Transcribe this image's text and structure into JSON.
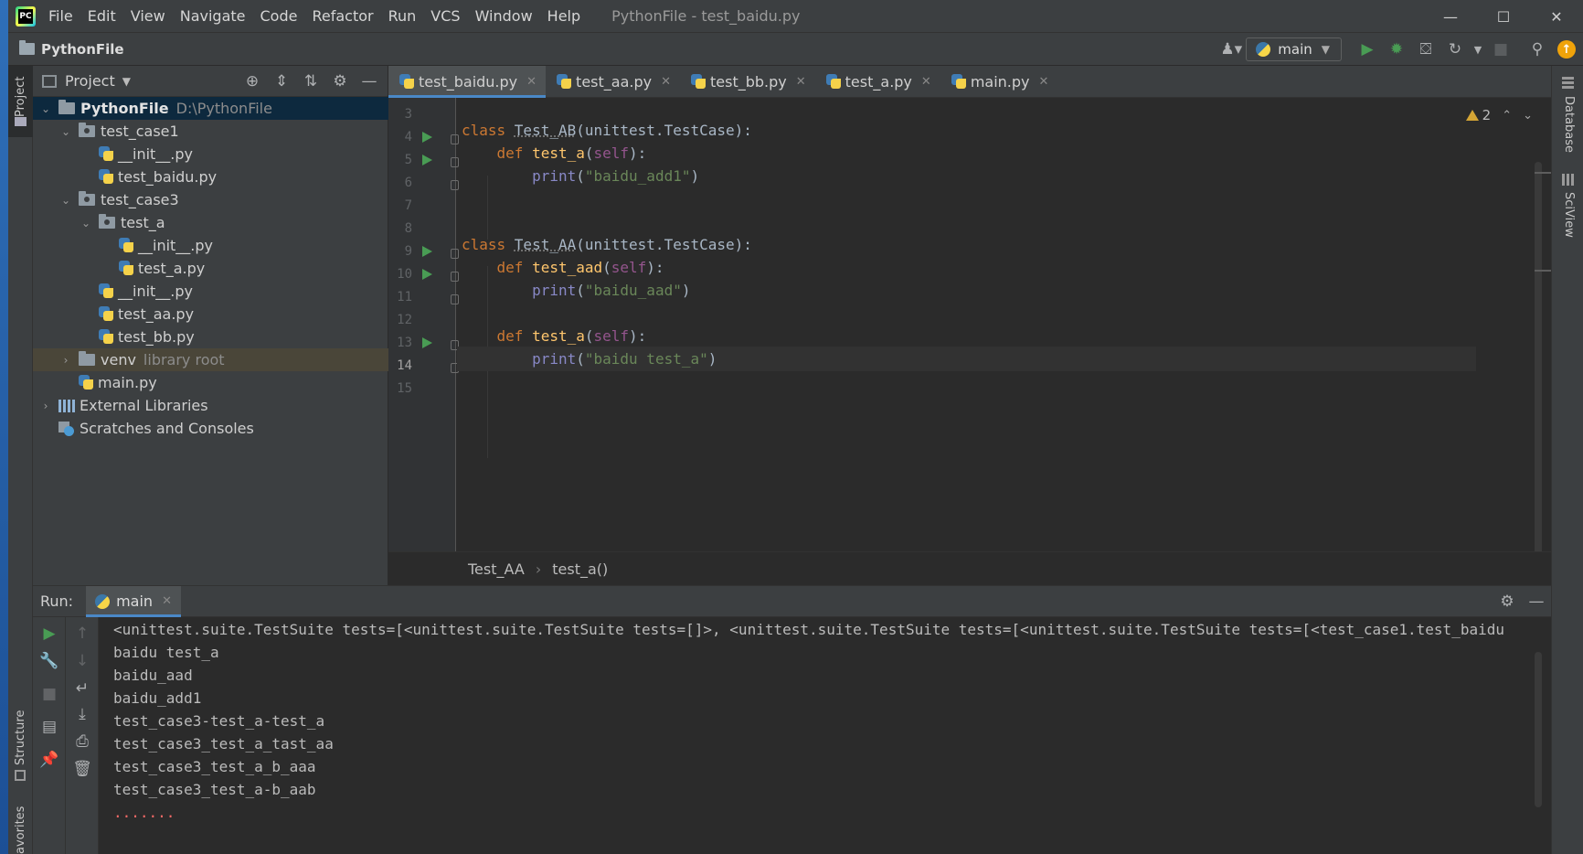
{
  "titlebar": {
    "menu": [
      "File",
      "Edit",
      "View",
      "Navigate",
      "Code",
      "Refactor",
      "Run",
      "VCS",
      "Window",
      "Help"
    ],
    "window_title": "PythonFile - test_baidu.py",
    "minimize_glyph": "—",
    "maximize_glyph": "☐",
    "close_glyph": "✕"
  },
  "navbar": {
    "project_name": "PythonFile",
    "run_config": "main"
  },
  "left_strip": {
    "project_label": "Project",
    "structure_label": "Structure",
    "favorites_label": "avorites"
  },
  "right_strip": {
    "database_label": "Database",
    "sciview_label": "SciView"
  },
  "project_panel": {
    "title": "Project",
    "tree": {
      "root_name": "PythonFile",
      "root_path": "D:\\PythonFile",
      "test_case1": "test_case1",
      "init1": "__init__.py",
      "test_baidu": "test_baidu.py",
      "test_case3": "test_case3",
      "test_a_dir": "test_a",
      "init_a": "__init__.py",
      "test_a_py": "test_a.py",
      "init3": "__init__.py",
      "test_aa": "test_aa.py",
      "test_bb": "test_bb.py",
      "venv": "venv",
      "venv_note": "library root",
      "main_py": "main.py",
      "external_libraries": "External Libraries",
      "scratches": "Scratches and Consoles"
    }
  },
  "editor": {
    "tabs": [
      {
        "label": "test_baidu.py",
        "active": true
      },
      {
        "label": "test_aa.py",
        "active": false
      },
      {
        "label": "test_bb.py",
        "active": false
      },
      {
        "label": "test_a.py",
        "active": false
      },
      {
        "label": "main.py",
        "active": false
      }
    ],
    "line_numbers": [
      "3",
      "4",
      "5",
      "6",
      "7",
      "8",
      "9",
      "10",
      "11",
      "12",
      "13",
      "14",
      "15"
    ],
    "current_line": "14",
    "code": {
      "l4_kw": "class ",
      "l4_name": "Test_AB",
      "l4_rest": "(unittest.TestCase):",
      "l5_kw": "def ",
      "l5_fn": "test_a",
      "l5_self": "self",
      "l6_print": "print",
      "l6_str": "\"baidu_add1\"",
      "l9_kw": "class ",
      "l9_name": "Test_AA",
      "l9_rest": "(unittest.TestCase):",
      "l10_kw": "def ",
      "l10_fn": "test_aad",
      "l10_self": "self",
      "l11_print": "print",
      "l11_str": "\"baidu_aad\"",
      "l13_kw": "def ",
      "l13_fn": "test_a",
      "l13_self": "self",
      "l14_print": "print",
      "l14_str": "\"baidu test_a\""
    },
    "warning_count": "2",
    "breadcrumb": [
      "Test_AA",
      "test_a()"
    ]
  },
  "run_panel": {
    "label": "Run:",
    "tab": "main",
    "output": [
      "<unittest.suite.TestSuite tests=[<unittest.suite.TestSuite tests=[]>, <unittest.suite.TestSuite tests=[<unittest.suite.TestSuite tests=[<test_case1.test_baidu",
      "baidu test_a",
      "baidu_aad",
      "baidu_add1",
      "test_case3-test_a-test_a",
      "test_case3_test_a_tast_aa",
      "test_case3_test_a_b_aaa",
      "test_case3_test_a-b_aab"
    ],
    "output_tail": "......."
  },
  "colors": {
    "keyword": "#cc7832",
    "function": "#ffc66d",
    "string": "#6a8759",
    "self": "#94558d",
    "builtin": "#8888c6",
    "run_green": "#499c54",
    "accent_blue": "#4a88c7"
  }
}
